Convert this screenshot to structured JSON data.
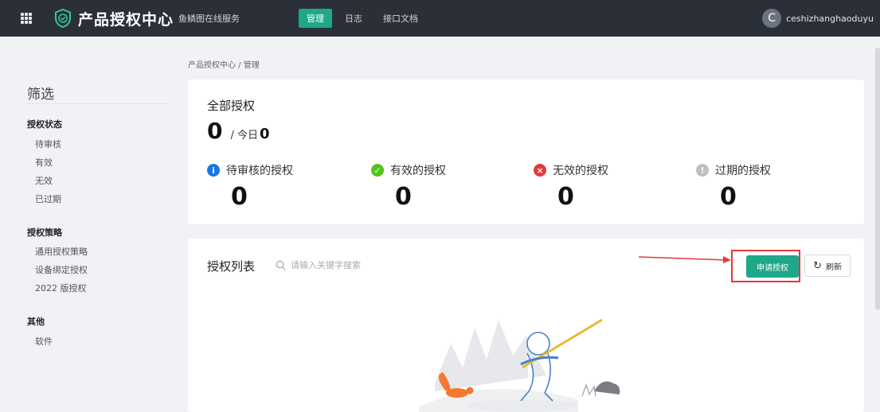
{
  "header": {
    "app_title": "产品授权中心",
    "app_subtitle": "鱼鳞图在线服务",
    "tabs": [
      {
        "label": "管理",
        "active": true
      },
      {
        "label": "日志",
        "active": false
      },
      {
        "label": "接口文档",
        "active": false
      }
    ],
    "user": {
      "initial": "C",
      "name": "ceshizhanghaoduyu"
    }
  },
  "sidebar": {
    "title": "筛选",
    "groups": [
      {
        "title": "授权状态",
        "items": [
          "待审核",
          "有效",
          "无效",
          "已过期"
        ]
      },
      {
        "title": "授权策略",
        "items": [
          "通用授权策略",
          "设备绑定授权",
          "2022 版授权"
        ]
      },
      {
        "title": "其他",
        "items": [
          "软件"
        ]
      }
    ]
  },
  "breadcrumb": "产品授权中心 / 管理",
  "summary": {
    "title": "全部授权",
    "total": "0",
    "today_label": "/ 今日",
    "today_value": "0",
    "stats": [
      {
        "label": "待审核的授权",
        "value": "0",
        "icon": "info-icon",
        "color": "#1677e5"
      },
      {
        "label": "有效的授权",
        "value": "0",
        "icon": "check-icon",
        "color": "#52c41a"
      },
      {
        "label": "无效的授权",
        "value": "0",
        "icon": "close-icon",
        "color": "#e4393c"
      },
      {
        "label": "过期的授权",
        "value": "0",
        "icon": "exclamation-icon",
        "color": "#bfbfbf"
      }
    ]
  },
  "list": {
    "title": "授权列表",
    "search_placeholder": "请输入关键字搜索",
    "apply_label": "申请授权",
    "refresh_label": "刷新"
  },
  "colors": {
    "accent": "#1ea789",
    "topbar": "#2b2f38",
    "highlight": "#e4393c"
  }
}
